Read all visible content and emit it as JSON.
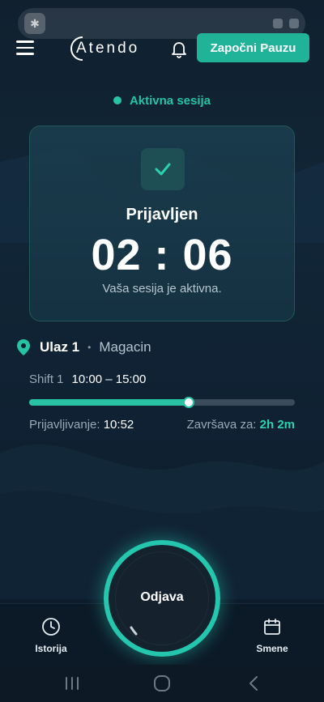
{
  "colors": {
    "accent": "#20b39a",
    "accent_text": "#26c4a3",
    "background": "#0f1d2b",
    "card_border": "#1f5a5a",
    "progress_track": "#3a4b5b"
  },
  "header": {
    "app_name": "Atendo",
    "menu_icon": "hamburger-menu-icon",
    "notification_icon": "bell-icon",
    "pause_button": "Započni Pauzu"
  },
  "session": {
    "status": "Aktivna sesija",
    "check_icon": "check-icon",
    "title": "Prijavljen",
    "timer": "02 : 06",
    "subtitle": "Vaša sesija je aktivna."
  },
  "location": {
    "icon": "location-pin-icon",
    "entrance": "Ulaz 1",
    "separator": "•",
    "place": "Magacin"
  },
  "shift": {
    "label": "Shift 1",
    "time": "10:00 – 15:00",
    "progress": 0.6,
    "checkin_label": "Prijavljivanje:",
    "checkin_value": "10:52",
    "ends_label": "Završava za:",
    "ends_value": "2h 2m"
  },
  "bottom_nav": {
    "history": {
      "label": "Istorija",
      "icon": "clock-icon"
    },
    "logout": {
      "label": "Odjava"
    },
    "shifts": {
      "label": "Smene",
      "icon": "calendar-icon"
    }
  },
  "system_nav": {
    "recents_icon": "recents-icon",
    "home_icon": "home-icon",
    "back_icon": "back-icon"
  }
}
